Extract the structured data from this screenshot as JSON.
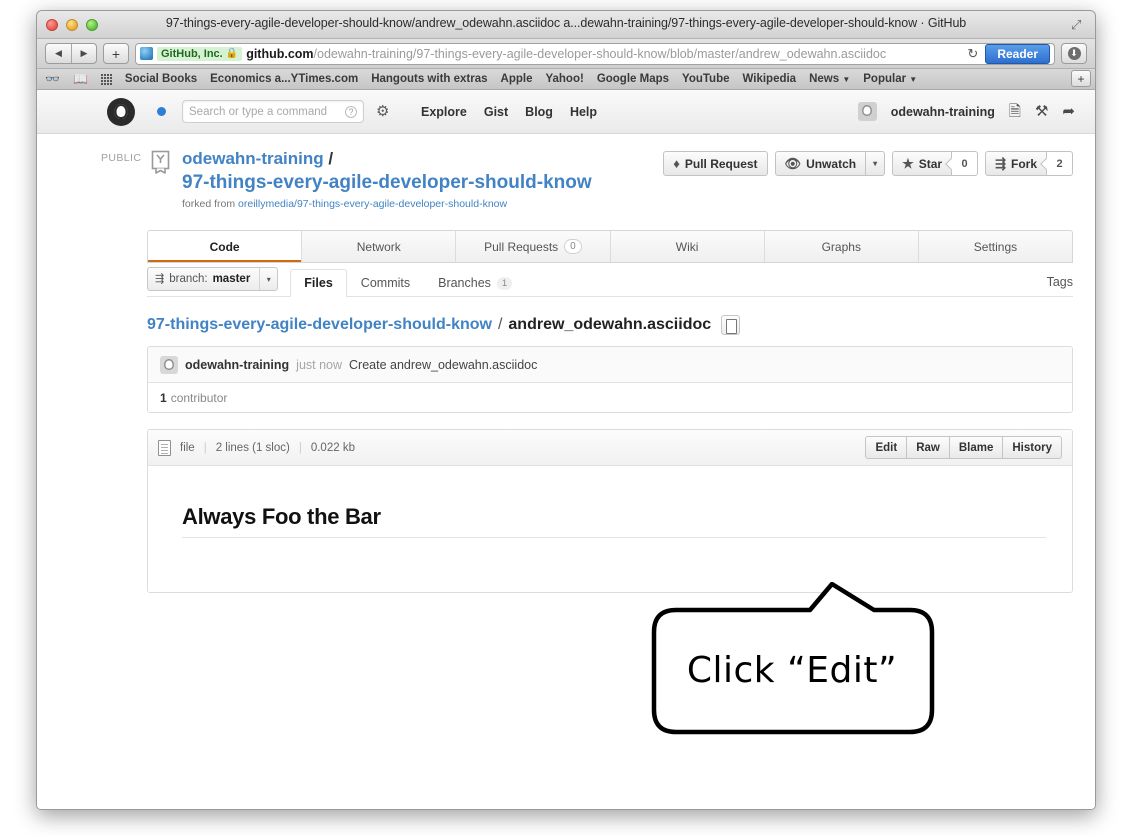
{
  "browser": {
    "window_title": "97-things-every-agile-developer-should-know/andrew_odewahn.asciidoc a...dewahn-training/97-things-every-agile-developer-should-know · GitHub",
    "back_glyph": "◀",
    "forward_glyph": "▶",
    "new_tab_glyph": "+",
    "ev_label": "GitHub, Inc.",
    "lock_glyph": "🔒",
    "url_host": "github.com",
    "url_path": "/odewahn-training/97-things-every-agile-developer-should-know/blob/master/andrew_odewahn.asciidoc",
    "reload_glyph": "↻",
    "reader_label": "Reader",
    "download_glyph": "⬇",
    "bookmarks": [
      {
        "label": "Social Books",
        "caret": false
      },
      {
        "label": "Economics a...YTimes.com",
        "caret": false
      },
      {
        "label": "Hangouts with extras",
        "caret": false
      },
      {
        "label": "Apple",
        "caret": false
      },
      {
        "label": "Yahoo!",
        "caret": false
      },
      {
        "label": "Google Maps",
        "caret": false
      },
      {
        "label": "YouTube",
        "caret": false
      },
      {
        "label": "Wikipedia",
        "caret": false
      },
      {
        "label": "News",
        "caret": true
      },
      {
        "label": "Popular",
        "caret": true
      }
    ],
    "bookmark_add_glyph": "+"
  },
  "gh_header": {
    "search_placeholder": "Search or type a command",
    "help_glyph": "?",
    "gear_glyph": "✵",
    "nav": [
      {
        "label": "Explore"
      },
      {
        "label": "Gist"
      },
      {
        "label": "Blog"
      },
      {
        "label": "Help"
      }
    ],
    "username": "odewahn-training",
    "icons": [
      {
        "name": "create-new-repo-icon",
        "glyph": "▤"
      },
      {
        "name": "tools-icon",
        "glyph": "✕"
      },
      {
        "name": "logout-icon",
        "glyph": "⎋"
      }
    ]
  },
  "repo": {
    "visibility": "PUBLIC",
    "owner": "odewahn-training",
    "separator": "/",
    "name": "97-things-every-agile-developer-should-know",
    "forked_prefix": "forked from",
    "forked_source": "oreillymedia/97-things-every-agile-developer-should-know",
    "actions": {
      "pull_request": "Pull Request",
      "unwatch": "Unwatch",
      "star": "Star",
      "star_count": "0",
      "fork": "Fork",
      "fork_count": "2",
      "caret": "▾"
    }
  },
  "tabs": [
    {
      "label": "Code",
      "count": null,
      "active": true
    },
    {
      "label": "Network",
      "count": null,
      "active": false
    },
    {
      "label": "Pull Requests",
      "count": "0",
      "active": false
    },
    {
      "label": "Wiki",
      "count": null,
      "active": false
    },
    {
      "label": "Graphs",
      "count": null,
      "active": false
    },
    {
      "label": "Settings",
      "count": null,
      "active": false
    }
  ],
  "subnav": {
    "branch_prefix": "branch:",
    "branch_name": "master",
    "branch_caret": "▾",
    "items": [
      {
        "label": "Files",
        "count": null,
        "active": true
      },
      {
        "label": "Commits",
        "count": null,
        "active": false
      },
      {
        "label": "Branches",
        "count": "1",
        "active": false
      }
    ],
    "tags_label": "Tags"
  },
  "breadcrumb": {
    "repo": "97-things-every-agile-developer-should-know",
    "slash": "/",
    "filename": "andrew_odewahn.asciidoc"
  },
  "commit": {
    "author": "odewahn-training",
    "time": "just now",
    "message": "Create andrew_odewahn.asciidoc",
    "contributor_count": "1",
    "contributor_label": "contributor"
  },
  "file": {
    "type_label": "file",
    "lines": "2 lines (1 sloc)",
    "size": "0.022 kb",
    "buttons": [
      {
        "label": "Edit"
      },
      {
        "label": "Raw"
      },
      {
        "label": "Blame"
      },
      {
        "label": "History"
      }
    ],
    "heading": "Always Foo the Bar"
  },
  "callout": {
    "text": "Click “Edit”"
  },
  "colors": {
    "link_blue": "#4183c4",
    "tab_active_underline": "#d26911",
    "reader_blue": "#2d6fd0",
    "ev_green": "#1d6b21"
  }
}
